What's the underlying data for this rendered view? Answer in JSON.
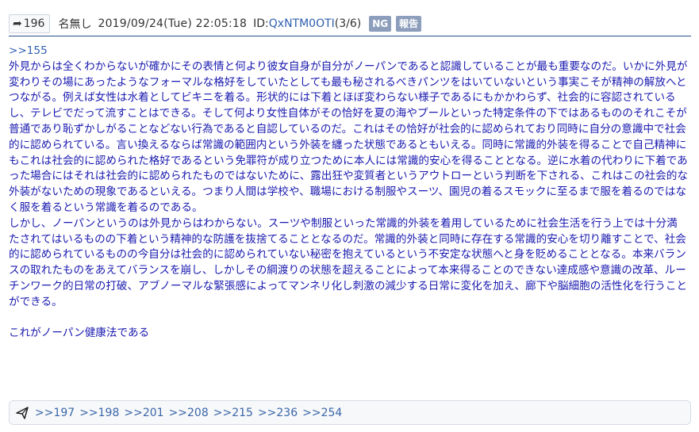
{
  "header": {
    "arrow_icon": "share-arrow-icon",
    "post_number": "196",
    "name": "名無し",
    "date": "2019/09/24(Tue) 22:05:18",
    "id_label": "ID:",
    "id_value": "QxNTM0OTI",
    "id_count": "(3/6)",
    "ng_label": "NG",
    "report_label": "報告"
  },
  "body": {
    "quote_anchor": ">>155",
    "paragraph1": "外見からは全くわからないが確かにその表情と何より彼女自身が自分がノーパンであると認識していることが最も重要なのだ。いかに外見が変わりその場にあったようなフォーマルな格好をしていたとしても最も秘されるべきパンツをはいていないという事実こそが精神の解放へとつながる。例えば女性は水着としてビキニを着る。形状的には下着とほぼ変わらない様子であるにもかかわらず、社会的に容認されているし、テレビでだって流すことはできる。そして何より女性自体がその恰好を夏の海やプールといった特定条件の下ではあるもののそれこそが普通であり恥ずかしがることなどない行為であると自認しているのだ。これはその恰好が社会的に認められており同時に自分の意識中で社会的に認められている。言い換えるならば常識の範囲内という外装を纏った状態であるともいえる。同時に常識的外装を得ることで自己精神にもこれは社会的に認められた格好であるという免罪符が成り立つために本人には常識的安心を得ることとなる。逆に水着の代わりに下着であった場合にはそれは社会的に認められたものではないために、露出狂や変質者というアウトローという判断を下される、これはこの社会的な外装がないための現象であるといえる。つまり人間は学校や、職場における制服やスーツ、園児の着るスモックに至るまで服を着るのではなく服を着るという常識を着るのである。",
    "paragraph2": "しかし、ノーパンというのは外見からはわからない。スーツや制服といった常識的外装を着用しているために社会生活を行う上では十分満たされてはいるものの下着という精神的な防護を抜捨てることとなるのだ。常識的外装と同時に存在する常識的安心を切り離すことで、社会的に認められているものの今自分は社会的に認められていない秘密を抱えているという不安定な状態へと身を貶めることとなる。本来バランスの取れたものをあえてバランスを崩し、しかしその綱渡りの状態を超えることによって本来得ることのできない達成感や意識の改革、ルーチンワーク的日常の打破、アブノーマルな緊張感によってマンネリ化し刺激の減少する日常に変化を加え、廊下や脳細胞の活性化を行うことができる。",
    "conclusion": "これがノーパン健康法である"
  },
  "footer": {
    "reply_icon": "paper-plane-icon",
    "replies": [
      ">>197",
      ">>198",
      ">>201",
      ">>208",
      ">>215",
      ">>236",
      ">>254"
    ]
  }
}
